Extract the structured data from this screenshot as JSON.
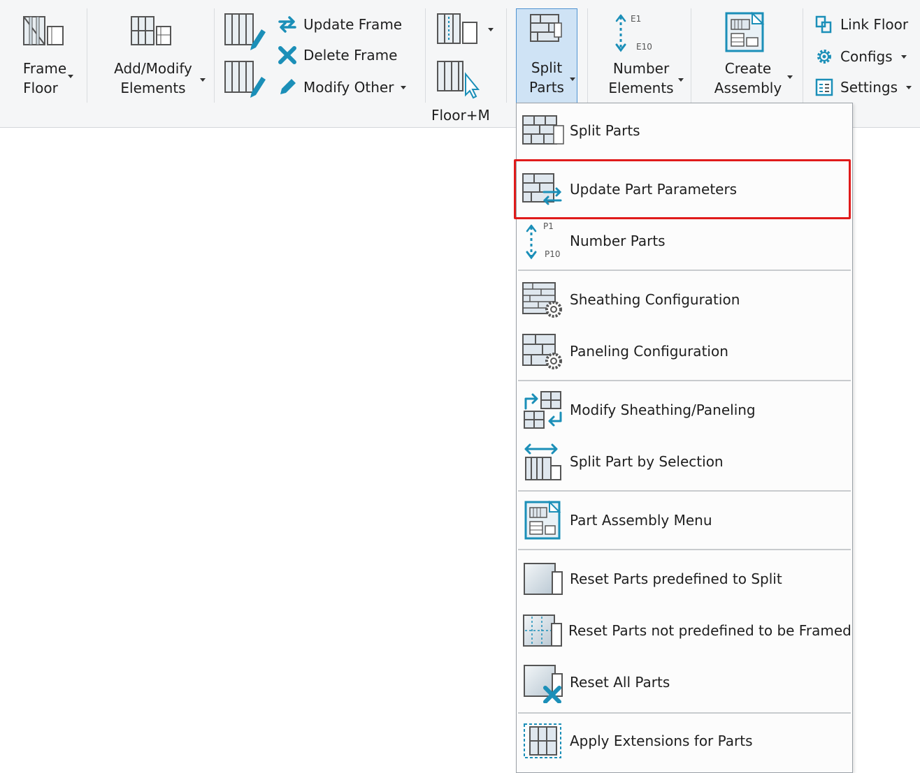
{
  "ribbon": {
    "frame_floor": {
      "line1": "Frame",
      "line2": "Floor"
    },
    "add_modify": {
      "line1": "Add/Modify",
      "line2": "Elements"
    },
    "update_frame": "Update Frame",
    "delete_frame": "Delete Frame",
    "modify_other": "Modify Other",
    "floor_m": "Floor+M",
    "split_parts": {
      "line1": "Split",
      "line2": "Parts"
    },
    "number_elements": {
      "line1": "Number",
      "line2": "Elements",
      "tag_top": "E1",
      "tag_bottom": "E10"
    },
    "create_assembly": {
      "line1": "Create",
      "line2": "Assembly"
    },
    "link_floor": "Link Floor",
    "configs": "Configs",
    "settings": "Settings"
  },
  "menu": {
    "items": [
      {
        "label": "Split Parts"
      },
      {
        "label": "Update Part Parameters"
      },
      {
        "label": "Number Parts",
        "tag_top": "P1",
        "tag_bottom": "P10"
      },
      {
        "label": "Sheathing Configuration"
      },
      {
        "label": "Paneling Configuration"
      },
      {
        "label": "Modify Sheathing/Paneling"
      },
      {
        "label": "Split Part by Selection"
      },
      {
        "label": "Part Assembly Menu"
      },
      {
        "label": "Reset Parts predefined to Split"
      },
      {
        "label": "Reset Parts not predefined to be Framed"
      },
      {
        "label": "Reset All Parts"
      },
      {
        "label": "Apply Extensions for Parts"
      }
    ]
  },
  "colors": {
    "accent": "#1b8fb8",
    "highlight": "#e01b1b",
    "active_bg": "#cfe3f5"
  }
}
